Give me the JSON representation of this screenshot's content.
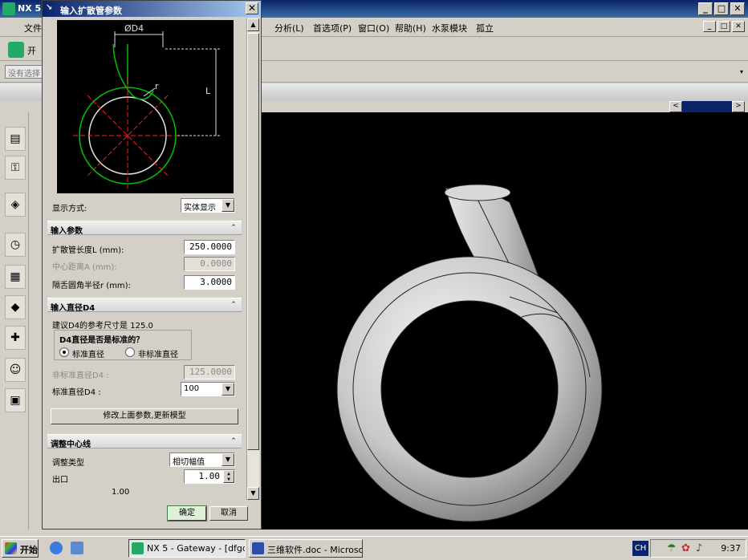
{
  "app": {
    "title": "NX 5",
    "menu": [
      "文件",
      "分析(L)",
      "首选项(P)",
      "窗口(O)",
      "帮助(H)",
      "水泵模块",
      "孤立"
    ],
    "toolbar_start": "开",
    "selection_placeholder": "没有选择",
    "win_min": "_",
    "win_max": "□",
    "win_close": "✕"
  },
  "dialog": {
    "title": "输入扩散管参数",
    "close": "✕",
    "preview": {
      "d4_label": "ØD4",
      "l_label": "L",
      "r_label": "r"
    },
    "display_mode_label": "显示方式:",
    "display_mode_value": "实体显示",
    "sections": {
      "input_params": "输入参数",
      "input_diameter": "输入直径D4",
      "adjust_centerline": "调整中心线"
    },
    "fields": {
      "length_label": "扩散管长度L (mm):",
      "length_value": "250.0000",
      "center_distance_label": "中心距离A (mm):",
      "center_distance_value": "0.0000",
      "tongue_radius_label": "隔舌圆角半径r (mm):",
      "tongue_radius_value": "3.0000"
    },
    "diameter": {
      "suggest_text": "建议D4的参考尺寸是 125.0",
      "question": "D4直径是否是标准的？",
      "standard": "标准直径",
      "nonstandard": "非标准直径",
      "nonstd_label": "非标准直径D4 :",
      "nonstd_value": "125.0000",
      "std_label": "标准直径D4 :",
      "std_value": "100"
    },
    "update_button": "修改上面参数,更新模型",
    "adjust": {
      "type_label": "调整类型",
      "type_value": "相切幅值",
      "outlet_label": "出口",
      "outlet_value": "1.00",
      "outlet_readout": "1.00"
    },
    "ok": "确定",
    "cancel": "取消"
  },
  "taskbar": {
    "start": "开始",
    "tasks": [
      "NX 5 - Gateway - [dfgdf...",
      "三维软件.doc - Microso..."
    ],
    "lang": "CH",
    "clock": "9:37"
  }
}
